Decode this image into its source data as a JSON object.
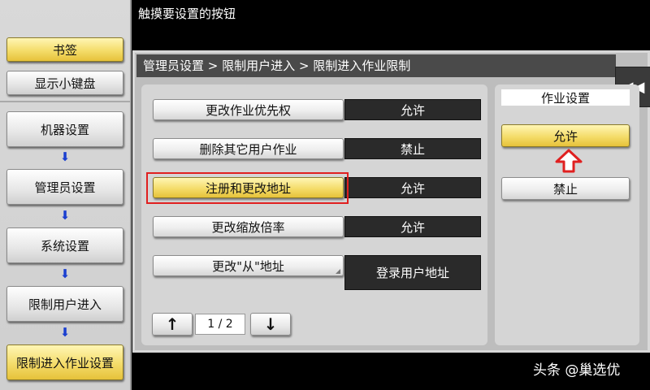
{
  "prompt": "触摸要设置的按钮",
  "sidebar": {
    "bookmark": "书签",
    "keypad": "显示小键盘",
    "nav": [
      "机器设置",
      "管理员设置",
      "系统设置",
      "限制用户进入",
      "限制进入作业设置"
    ]
  },
  "breadcrumb": "管理员设置 > 限制用户进入 > 限制进入作业限制",
  "settings": [
    {
      "label": "更改作业优先权",
      "value": "允许"
    },
    {
      "label": "删除其它用户作业",
      "value": "禁止"
    },
    {
      "label": "注册和更改地址",
      "value": "允许"
    },
    {
      "label": "更改缩放倍率",
      "value": "允许"
    },
    {
      "label": "更改\"从\"地址",
      "value": "登录用户地址"
    }
  ],
  "pager": {
    "indicator": "1 / 2"
  },
  "job_setting": {
    "title": "作业设置",
    "allow": "允许",
    "deny": "禁止"
  },
  "watermark": "头条 @巢选优",
  "colors": {
    "selected": "#f4dc6a",
    "highlight": "#e02020",
    "value_bg": "#2a2a2a"
  }
}
